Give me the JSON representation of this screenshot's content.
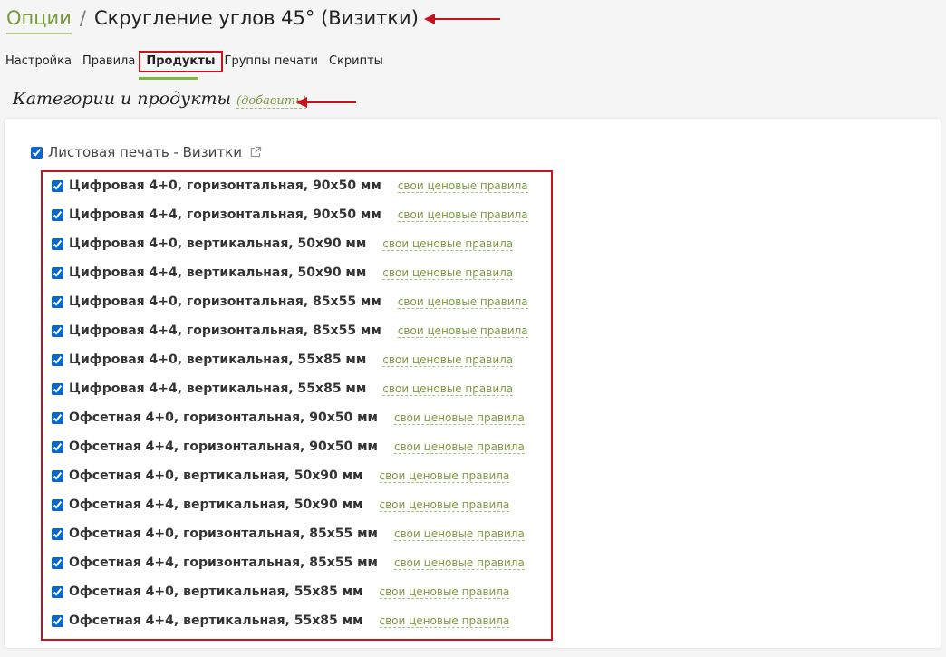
{
  "header": {
    "breadcrumb_link": "Опции",
    "separator": "/",
    "title": "Скругление углов 45° (Визитки)"
  },
  "tabs": [
    {
      "label": "Настройка",
      "active": false
    },
    {
      "label": "Правила",
      "active": false
    },
    {
      "label": "Продукты",
      "active": true
    },
    {
      "label": "Группы печати",
      "active": false
    },
    {
      "label": "Скрипты",
      "active": false
    }
  ],
  "section": {
    "title": "Категории и продукты",
    "add_link": "(добавить)"
  },
  "category": {
    "label": "Листовая печать - Визитки",
    "checked": true
  },
  "products": [
    {
      "name": "Цифровая 4+0, горизонтальная, 90x50 мм",
      "rules": "свои ценовые правила",
      "checked": true
    },
    {
      "name": "Цифровая 4+4, горизонтальная, 90x50 мм",
      "rules": "свои ценовые правила",
      "checked": true
    },
    {
      "name": "Цифровая 4+0, вертикальная, 50x90 мм",
      "rules": "свои ценовые правила",
      "checked": true
    },
    {
      "name": "Цифровая 4+4, вертикальная, 50x90 мм",
      "rules": "свои ценовые правила",
      "checked": true
    },
    {
      "name": "Цифровая 4+0, горизонтальная, 85x55 мм",
      "rules": "свои ценовые правила",
      "checked": true
    },
    {
      "name": "Цифровая 4+4, горизонтальная, 85x55 мм",
      "rules": "свои ценовые правила",
      "checked": true
    },
    {
      "name": "Цифровая 4+0, вертикальная, 55x85 мм",
      "rules": "свои ценовые правила",
      "checked": true
    },
    {
      "name": "Цифровая 4+4, вертикальная, 55x85 мм",
      "rules": "свои ценовые правила",
      "checked": true
    },
    {
      "name": "Офсетная 4+0, горизонтальная, 90x50 мм",
      "rules": "свои ценовые правила",
      "checked": true
    },
    {
      "name": "Офсетная 4+4, горизонтальная, 90x50 мм",
      "rules": "свои ценовые правила",
      "checked": true
    },
    {
      "name": "Офсетная 4+0, вертикальная, 50x90 мм",
      "rules": "свои ценовые правила",
      "checked": true
    },
    {
      "name": "Офсетная 4+4, вертикальная, 50x90 мм",
      "rules": "свои ценовые правила",
      "checked": true
    },
    {
      "name": "Офсетная 4+0, горизонтальная, 85x55 мм",
      "rules": "свои ценовые правила",
      "checked": true
    },
    {
      "name": "Офсетная 4+4, горизонтальная, 85x55 мм",
      "rules": "свои ценовые правила",
      "checked": true
    },
    {
      "name": "Офсетная 4+0, вертикальная, 55x85 мм",
      "rules": "свои ценовые правила",
      "checked": true
    },
    {
      "name": "Офсетная 4+4, вертикальная, 55x85 мм",
      "rules": "свои ценовые правила",
      "checked": true
    }
  ],
  "icons": {
    "external_link": "external-link-icon",
    "arrow": "arrow-left-icon"
  },
  "colors": {
    "accent_green": "#7a9a3c",
    "highlight_red": "#c8111f",
    "checkbox_blue": "#0a66d1"
  }
}
